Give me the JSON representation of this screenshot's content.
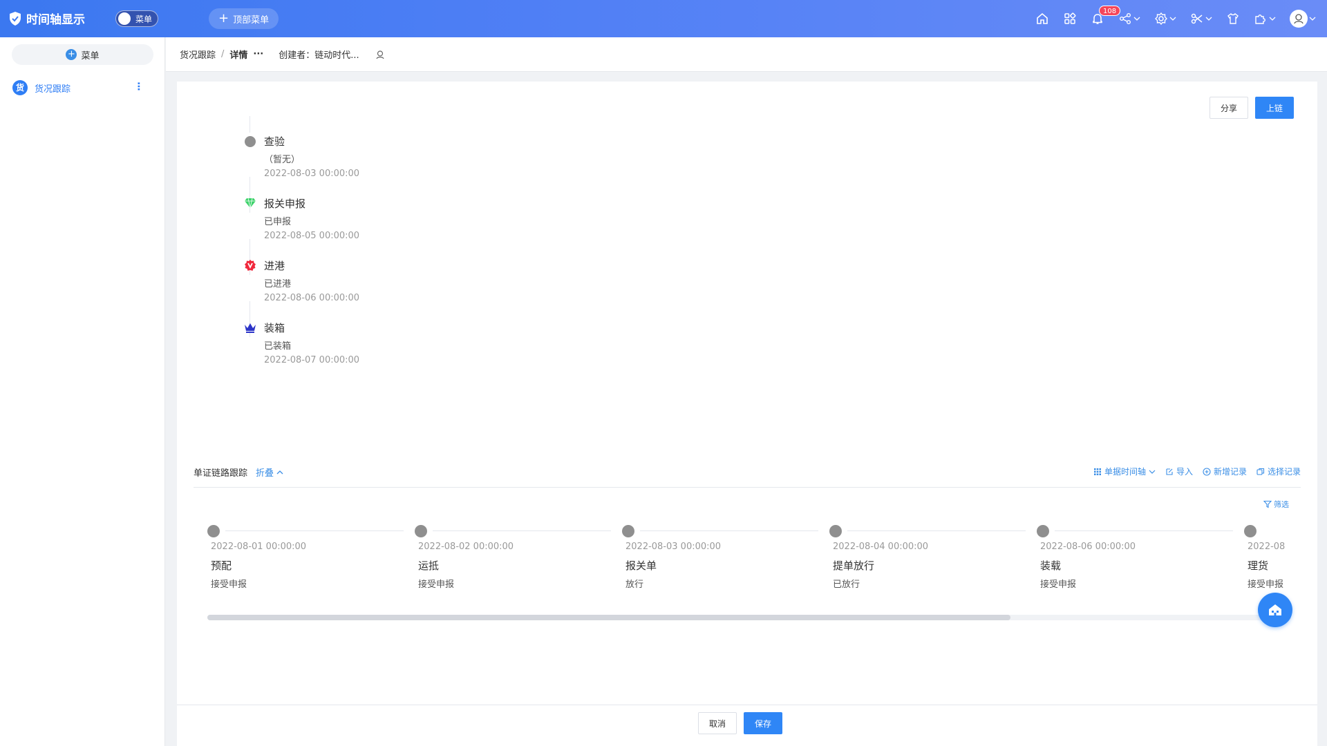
{
  "app": {
    "title": "时间轴显示",
    "menu_toggle_label": "菜单",
    "top_menu_label": "顶部菜单",
    "notification_count": "108"
  },
  "sidebar": {
    "add_label": "菜单",
    "items": [
      {
        "icon_text": "货",
        "label": "货况跟踪"
      }
    ]
  },
  "breadcrumb": {
    "root": "货况跟踪",
    "current": "详情",
    "more": "···",
    "creator": "创建者：链动时代..."
  },
  "actions": {
    "share": "分享",
    "chain": "上链",
    "filter_top": "筛选"
  },
  "vertical_timeline": [
    {
      "title": "查验",
      "desc": "（暂无）",
      "time": "2022-08-03 00:00:00",
      "icon": "grey-dot"
    },
    {
      "title": "报关申报",
      "desc": "已申报",
      "time": "2022-08-05 00:00:00",
      "icon": "green-diamond-icon"
    },
    {
      "title": "进港",
      "desc": "已进港",
      "time": "2022-08-06 00:00:00",
      "icon": "red-v-badge-icon"
    },
    {
      "title": "装箱",
      "desc": "已装箱",
      "time": "2022-08-07 00:00:00",
      "icon": "blue-crown-icon"
    }
  ],
  "section": {
    "title": "单证链路跟踪",
    "fold": "折叠",
    "view_select": "单据时间轴",
    "import": "导入",
    "add_record": "新增记录",
    "select_record": "选择记录",
    "filter": "筛选"
  },
  "horizontal_timeline": [
    {
      "time": "2022-08-01 00:00:00",
      "title": "预配",
      "desc": "接受申报"
    },
    {
      "time": "2022-08-02 00:00:00",
      "title": "运抵",
      "desc": "接受申报"
    },
    {
      "time": "2022-08-03 00:00:00",
      "title": "报关单",
      "desc": "放行"
    },
    {
      "time": "2022-08-04 00:00:00",
      "title": "提单放行",
      "desc": "已放行"
    },
    {
      "time": "2022-08-06 00:00:00",
      "title": "装载",
      "desc": "接受申报"
    },
    {
      "time": "2022-08",
      "title": "理货",
      "desc": "接受申报"
    }
  ],
  "footer": {
    "cancel": "取消",
    "save": "保存"
  },
  "colors": {
    "primary": "#2f86f6",
    "topbar_start": "#3b78f0",
    "topbar_end": "#6a8cf7",
    "dot_grey": "#8f8f8f"
  }
}
